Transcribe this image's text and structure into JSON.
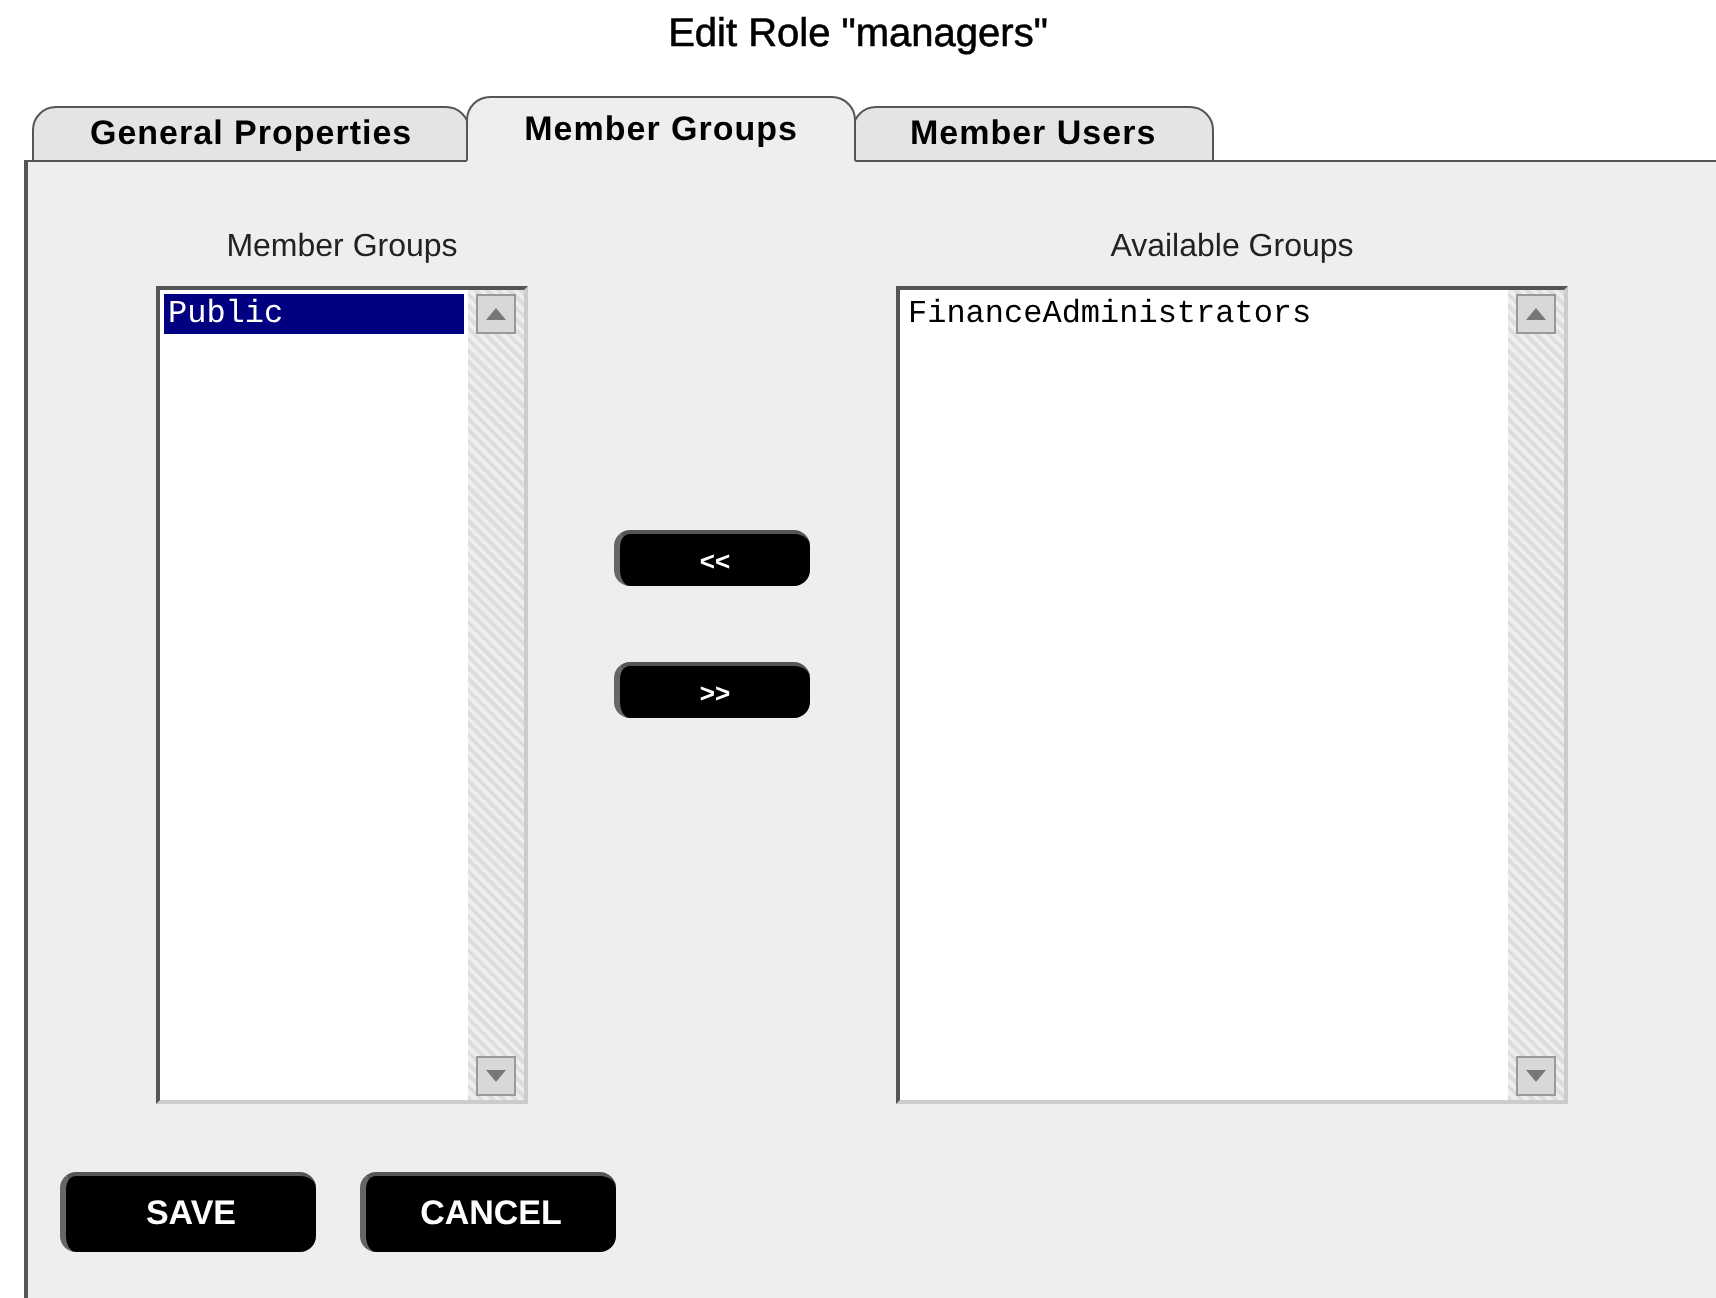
{
  "title": "Edit Role \"managers\"",
  "tabs": [
    {
      "label": "General Properties",
      "selected": false
    },
    {
      "label": "Member Groups",
      "selected": true
    },
    {
      "label": "Member Users",
      "selected": false
    }
  ],
  "member_groups": {
    "label": "Member Groups",
    "items": [
      {
        "label": "Public",
        "selected": true
      }
    ]
  },
  "move_buttons": [
    "<<",
    ">>"
  ],
  "available_groups": {
    "label": "Available Groups",
    "items": [
      {
        "label": "FinanceAdministrators",
        "selected": false
      }
    ]
  },
  "buttons": [
    "SAVE",
    "CANCEL"
  ]
}
